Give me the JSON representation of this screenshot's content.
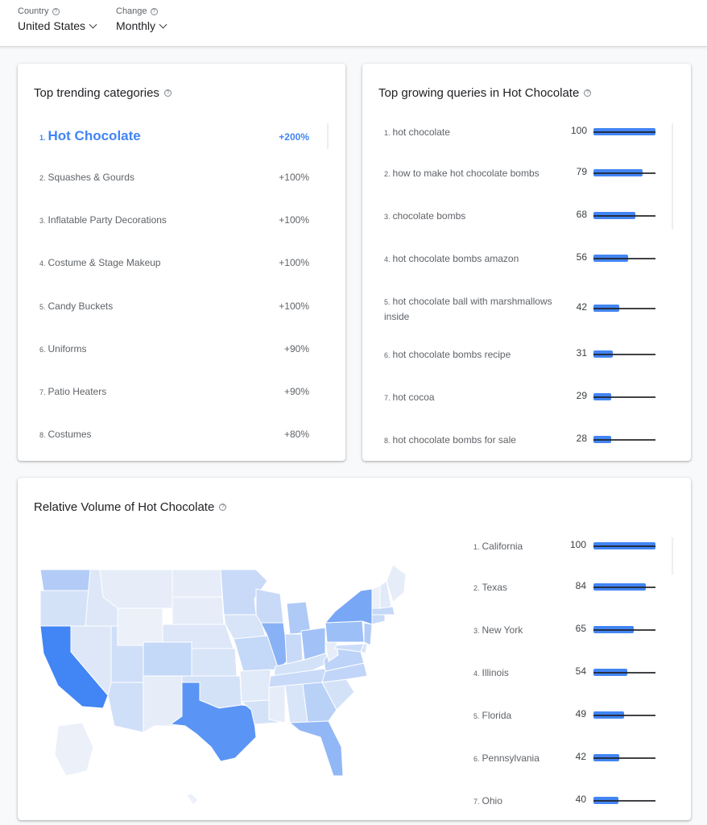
{
  "filters": {
    "country": {
      "label": "Country",
      "value": "United States"
    },
    "change": {
      "label": "Change",
      "value": "Monthly"
    }
  },
  "icons": {
    "help": "?"
  },
  "trending_categories": {
    "title": "Top trending categories",
    "items": [
      {
        "rank": "1.",
        "name": "Hot Chocolate",
        "change": "+200%"
      },
      {
        "rank": "2.",
        "name": "Squashes & Gourds",
        "change": "+100%"
      },
      {
        "rank": "3.",
        "name": "Inflatable Party Decorations",
        "change": "+100%"
      },
      {
        "rank": "4.",
        "name": "Costume & Stage Makeup",
        "change": "+100%"
      },
      {
        "rank": "5.",
        "name": "Candy Buckets",
        "change": "+100%"
      },
      {
        "rank": "6.",
        "name": "Uniforms",
        "change": "+90%"
      },
      {
        "rank": "7.",
        "name": "Patio Heaters",
        "change": "+90%"
      },
      {
        "rank": "8.",
        "name": "Costumes",
        "change": "+80%"
      }
    ]
  },
  "growing_queries": {
    "title": "Top growing queries in Hot Chocolate",
    "items": [
      {
        "rank": "1.",
        "name": "hot chocolate",
        "value": 100
      },
      {
        "rank": "2.",
        "name": "how to make hot chocolate bombs",
        "value": 79
      },
      {
        "rank": "3.",
        "name": "chocolate bombs",
        "value": 68
      },
      {
        "rank": "4.",
        "name": "hot chocolate bombs amazon",
        "value": 56
      },
      {
        "rank": "5.",
        "name": "hot chocolate ball with marshmallows inside",
        "value": 42
      },
      {
        "rank": "6.",
        "name": "hot chocolate bombs recipe",
        "value": 31
      },
      {
        "rank": "7.",
        "name": "hot cocoa",
        "value": 29
      },
      {
        "rank": "8.",
        "name": "hot chocolate bombs for sale",
        "value": 28
      }
    ]
  },
  "relative_volume": {
    "title": "Relative Volume of Hot Chocolate",
    "items": [
      {
        "rank": "1.",
        "name": "California",
        "value": 100
      },
      {
        "rank": "2.",
        "name": "Texas",
        "value": 84
      },
      {
        "rank": "3.",
        "name": "New York",
        "value": 65
      },
      {
        "rank": "4.",
        "name": "Illinois",
        "value": 54
      },
      {
        "rank": "5.",
        "name": "Florida",
        "value": 49
      },
      {
        "rank": "6.",
        "name": "Pennsylvania",
        "value": 42
      },
      {
        "rank": "7.",
        "name": "Ohio",
        "value": 40
      }
    ]
  },
  "colors": {
    "accent": "#4285f4",
    "map_max": "#4285f4",
    "map_min": "#f1f4f9"
  },
  "map_states": [
    {
      "name": "California",
      "value": 100
    },
    {
      "name": "Texas",
      "value": 84
    },
    {
      "name": "New York",
      "value": 65
    },
    {
      "name": "Illinois",
      "value": 54
    },
    {
      "name": "Florida",
      "value": 49
    },
    {
      "name": "Pennsylvania",
      "value": 42
    },
    {
      "name": "Ohio",
      "value": 40
    },
    {
      "name": "Washington",
      "value": 30
    },
    {
      "name": "Michigan",
      "value": 32
    },
    {
      "name": "New Jersey",
      "value": 30
    },
    {
      "name": "Georgia",
      "value": 26
    },
    {
      "name": "Virginia",
      "value": 24
    },
    {
      "name": "North Carolina",
      "value": 22
    },
    {
      "name": "Colorado",
      "value": 20
    },
    {
      "name": "Missouri",
      "value": 20
    },
    {
      "name": "Wisconsin",
      "value": 18
    },
    {
      "name": "Minnesota",
      "value": 18
    },
    {
      "name": "Indiana",
      "value": 18
    },
    {
      "name": "Massachusetts",
      "value": 20
    },
    {
      "name": "Tennessee",
      "value": 18
    },
    {
      "name": "Arizona",
      "value": 14
    },
    {
      "name": "Oregon",
      "value": 12
    },
    {
      "name": "Utah",
      "value": 14
    },
    {
      "name": "Kentucky",
      "value": 12
    },
    {
      "name": "South Carolina",
      "value": 12
    },
    {
      "name": "Alabama",
      "value": 10
    },
    {
      "name": "Louisiana",
      "value": 12
    },
    {
      "name": "Maryland",
      "value": 16
    },
    {
      "name": "Iowa",
      "value": 10
    },
    {
      "name": "Kansas",
      "value": 10
    },
    {
      "name": "Oklahoma",
      "value": 12
    },
    {
      "name": "Nevada",
      "value": 8
    },
    {
      "name": "Idaho",
      "value": 8
    },
    {
      "name": "Montana",
      "value": 4
    },
    {
      "name": "Wyoming",
      "value": 2
    },
    {
      "name": "North Dakota",
      "value": 4
    },
    {
      "name": "South Dakota",
      "value": 4
    },
    {
      "name": "Nebraska",
      "value": 8
    },
    {
      "name": "New Mexico",
      "value": 4
    },
    {
      "name": "Arkansas",
      "value": 6
    },
    {
      "name": "Mississippi",
      "value": 4
    },
    {
      "name": "West Virginia",
      "value": 4
    },
    {
      "name": "Maine",
      "value": 4
    },
    {
      "name": "Vermont",
      "value": 2
    },
    {
      "name": "New Hampshire",
      "value": 6
    },
    {
      "name": "Connecticut",
      "value": 18
    },
    {
      "name": "Delaware",
      "value": 10
    },
    {
      "name": "Alaska",
      "value": 2
    },
    {
      "name": "Hawaii",
      "value": 2
    }
  ]
}
